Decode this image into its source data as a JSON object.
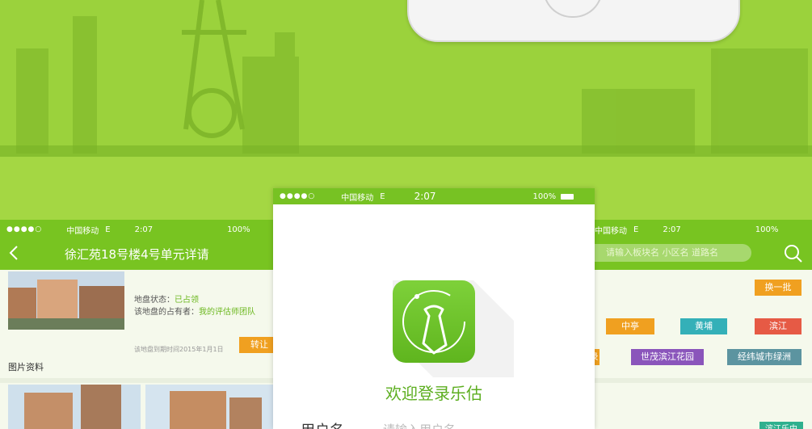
{
  "status_center": {
    "carrier": "中国移动",
    "network": "E",
    "time": "2:07",
    "battery": "100%"
  },
  "status_left": {
    "carrier": "中国移动",
    "network": "E",
    "time": "2:07",
    "battery": "100%"
  },
  "status_right": {
    "carrier": "中国移动",
    "network": "E",
    "time": "2:07",
    "battery": "100%"
  },
  "left": {
    "title": "徐汇苑18号楼4号单元详请",
    "status_label": "地盘状态：",
    "status_value": "已占领",
    "owner_label": "该地盘的占有者：",
    "owner_value": "我的评估师团队",
    "expire_text": "该地盘到期时间2015年1月1日",
    "transfer_button": "转让",
    "photos_title": "图片资料"
  },
  "center": {
    "welcome": "欢迎登录乐估",
    "username_label": "用户名",
    "username_placeholder": "请输入用户名"
  },
  "right": {
    "search_placeholder": "请输入板块名 小区名 道路名",
    "refresh_button": "换一批",
    "tags": [
      "中亭",
      "黄埔",
      "滨江",
      "录",
      "世茂滨江花园",
      "经纬城市绿洲"
    ],
    "bottom_badge": "滨江乐中"
  },
  "colors": {
    "brand": "#78c421",
    "orange": "#f0a020"
  }
}
